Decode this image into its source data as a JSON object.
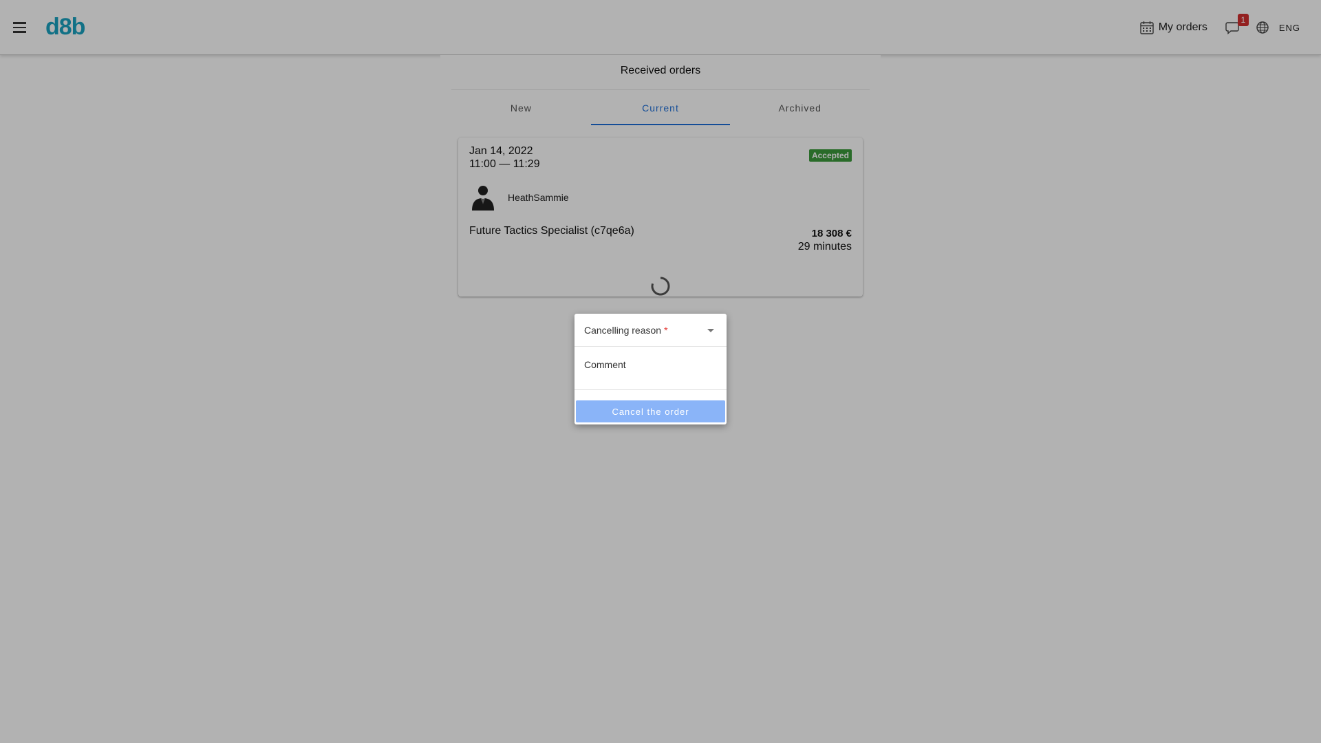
{
  "app": {
    "logo_text": "d8b"
  },
  "header": {
    "menu_icon": "hamburger-menu-icon",
    "orders_label": "My orders",
    "orders_icon": "calendar-icon",
    "chat_icon": "chat-bubble-icon",
    "chat_badge": "1",
    "language_icon": "globe-icon",
    "language_label": "ENG",
    "colors": {
      "logo": "#1ba3c0",
      "badge": "#d32f2f"
    }
  },
  "page": {
    "title": "Received orders",
    "tabs": [
      {
        "label": "New",
        "active": false
      },
      {
        "label": "Current",
        "active": true
      },
      {
        "label": "Archived",
        "active": false
      }
    ],
    "accent_color": "#1e6fd9"
  },
  "order": {
    "date": "Jan 14, 2022",
    "time_range": "11:00 — 11:29",
    "status": "Accepted",
    "status_color": "#3c9a3c",
    "username": "HeathSammie",
    "service": "Future Tactics Specialist (c7qe6a)",
    "price": "18 308 €",
    "duration": "29 minutes"
  },
  "dialog": {
    "reason_label": "Cancelling reason",
    "required_mark": "*",
    "comment_label": "Comment",
    "cancel_button": "Cancel the order",
    "button_color": "#8ab4f8"
  }
}
